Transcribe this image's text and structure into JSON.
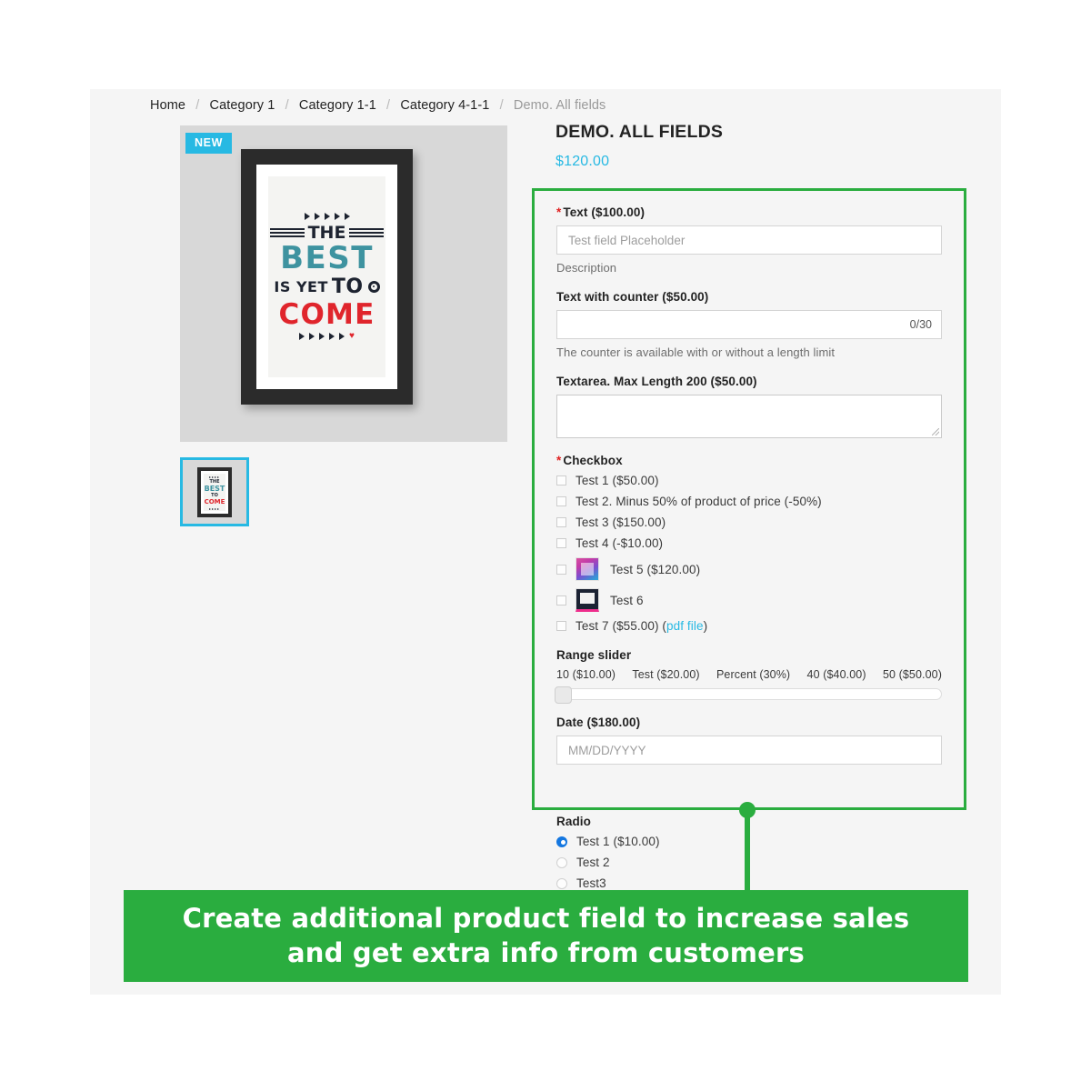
{
  "breadcrumb": {
    "items": [
      "Home",
      "Category 1",
      "Category 1-1",
      "Category 4-1-1",
      "Demo. All fields"
    ],
    "separator": "/"
  },
  "gallery": {
    "badge": "NEW",
    "poster": {
      "line1": "THE",
      "line2": "BEST",
      "line3a": "IS YET",
      "line3b": "TO",
      "line4": "COME"
    },
    "thumbnail_alt": "Demo. All fields poster thumbnail"
  },
  "product": {
    "title": "DEMO. ALL FIELDS",
    "price": "$120.00"
  },
  "fields": {
    "text": {
      "label": "Text ($100.00)",
      "required": true,
      "placeholder": "Test field Placeholder",
      "value": "",
      "description": "Description"
    },
    "text_counter": {
      "label": "Text with counter ($50.00)",
      "required": false,
      "value": "",
      "counter": "0/30",
      "description": "The counter is available with or without a length limit"
    },
    "textarea": {
      "label": "Textarea. Max Length 200 ($50.00)",
      "required": false,
      "value": ""
    },
    "checkbox": {
      "label": "Checkbox",
      "required": true,
      "options": [
        {
          "label": "Test 1 ($50.00)",
          "checked": false,
          "thumb": null
        },
        {
          "label": "Test 2. Minus 50% of product of price (-50%)",
          "checked": false,
          "thumb": null
        },
        {
          "label": "Test 3 ($150.00)",
          "checked": false,
          "thumb": null
        },
        {
          "label": "Test 4 (-$10.00)",
          "checked": false,
          "thumb": null
        },
        {
          "label": "Test 5 ($120.00)",
          "checked": false,
          "thumb": "t5"
        },
        {
          "label": "Test 6",
          "checked": false,
          "thumb": "t6"
        },
        {
          "label": "Test 7 ($55.00) ",
          "checked": false,
          "thumb": null,
          "link": "pdf file"
        }
      ]
    },
    "range": {
      "label": "Range slider",
      "ticks": [
        "10 ($10.00)",
        "Test ($20.00)",
        "Percent (30%)",
        "40 ($40.00)",
        "50 ($50.00)"
      ],
      "value_index": 0
    },
    "date": {
      "label": "Date ($180.00)",
      "placeholder": "MM/DD/YYYY",
      "value": ""
    },
    "radio": {
      "label": "Radio",
      "options": [
        {
          "label": "Test 1 ($10.00)",
          "checked": true
        },
        {
          "label": "Test 2",
          "checked": false
        },
        {
          "label": "Test3",
          "checked": false
        }
      ]
    }
  },
  "banner": {
    "line1": "Create additional product field to increase sales",
    "line2": "and get extra info from customers"
  },
  "colors": {
    "accent_cyan": "#27b9e3",
    "highlight_green": "#2aad3f",
    "required_red": "#e02020",
    "radio_blue": "#1477e0",
    "card_bg": "#f5f5f5"
  }
}
